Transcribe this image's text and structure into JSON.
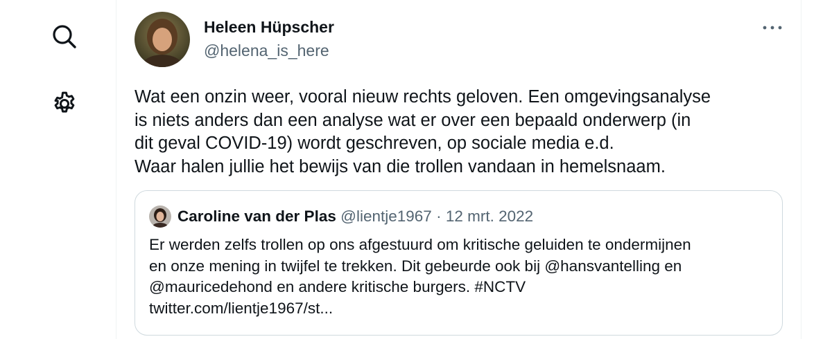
{
  "sidebar": {
    "icons": [
      "search-icon",
      "gear-icon"
    ]
  },
  "tweet": {
    "author_name": "Heleen Hüpscher",
    "author_handle": "@helena_is_here",
    "more_icon": "ellipsis-icon",
    "text_lines": [
      "Wat een onzin weer, vooral nieuw rechts geloven. Een omgevingsanalyse",
      "is niets anders dan een analyse wat er over een bepaald onderwerp (in",
      "dit geval COVID-19) wordt geschreven, op sociale media e.d.",
      "Waar halen jullie het bewijs van die trollen vandaan in hemelsnaam."
    ]
  },
  "quote": {
    "author_name": "Caroline van der Plas",
    "author_handle": "@lientje1967",
    "separator": "·",
    "date": "12 mrt. 2022",
    "text_lines": [
      "Er werden zelfs trollen op ons afgestuurd om kritische geluiden te ondermijnen",
      "en onze mening in twijfel te trekken. Dit gebeurde ook bij @hansvantelling en",
      "@mauricedehond en andere kritische burgers. #NCTV",
      "twitter.com/lientje1967/st..."
    ]
  },
  "colors": {
    "text_primary": "#0f1419",
    "text_secondary": "#536471",
    "border": "#cfd9de"
  }
}
